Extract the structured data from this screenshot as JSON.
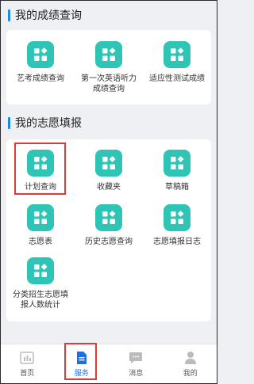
{
  "sections": [
    {
      "title": "我的成绩查询",
      "items": [
        {
          "label": "艺考成绩查询"
        },
        {
          "label": "第一次英语听力成绩查询"
        },
        {
          "label": "适应性测试成绩"
        }
      ]
    },
    {
      "title": "我的志愿填报",
      "items": [
        {
          "label": "计划查询"
        },
        {
          "label": "收藏夹"
        },
        {
          "label": "草稿箱"
        },
        {
          "label": "志愿表"
        },
        {
          "label": "历史志愿查询"
        },
        {
          "label": "志愿填报日志"
        },
        {
          "label": "分类招生志愿填报人数统计"
        }
      ]
    }
  ],
  "tabbar": {
    "items": [
      {
        "label": "首页",
        "icon": "chart-icon"
      },
      {
        "label": "服务",
        "icon": "document-icon",
        "active": true
      },
      {
        "label": "消息",
        "icon": "chat-icon"
      },
      {
        "label": "我的",
        "icon": "person-icon"
      }
    ]
  },
  "colors": {
    "accent": "#1e88e5",
    "tile": "#2ec4b6",
    "highlight": "#e53935",
    "tab_active": "#1e6fe0"
  }
}
